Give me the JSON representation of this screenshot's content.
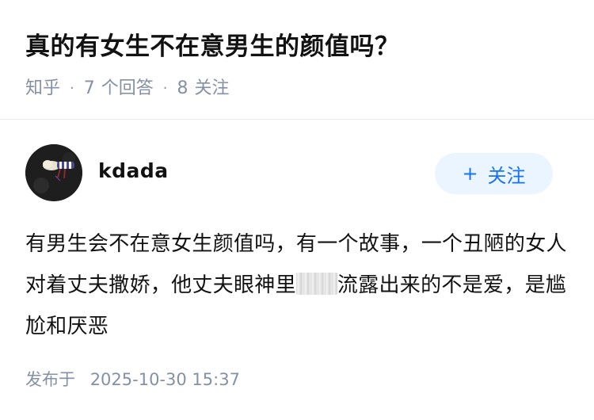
{
  "question": {
    "title": "真的有女生不在意男生的颜值吗？",
    "source": "知乎",
    "answer_count": "7",
    "answer_label": "个回答",
    "follower_count": "8",
    "follower_label": "关注"
  },
  "author": {
    "name": "kdada",
    "follow_button": {
      "icon": "+",
      "label": "关注"
    }
  },
  "answer": {
    "text_before": "有男生会不在意女生颜值吗，有一个故事，一个丑陋的女人对着丈夫撒娇，他丈夫眼神里",
    "text_after": "流露出来的不是爱，是尴尬和厌恶"
  },
  "publish": {
    "label": "发布于",
    "time": "2025-10-30 15:37"
  },
  "colors": {
    "accent": "#1772f6",
    "button_bg": "#ebf5ff",
    "meta_text": "#8590a6",
    "divider": "#ebebeb"
  }
}
